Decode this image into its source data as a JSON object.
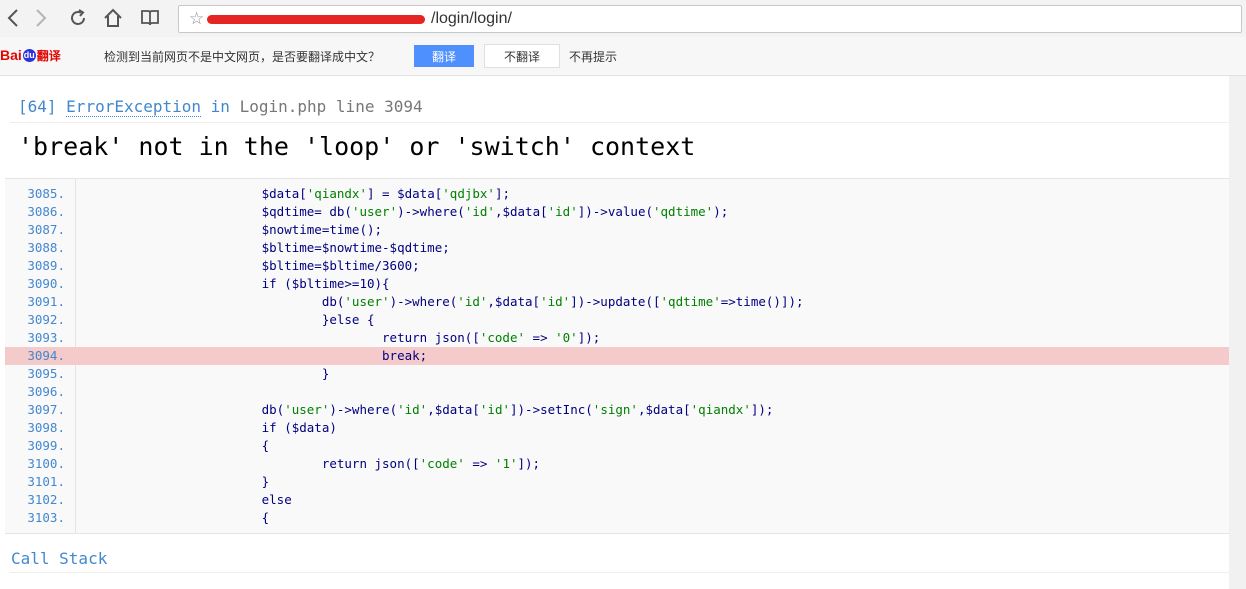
{
  "browser": {
    "url_visible": "/login/login/",
    "back_icon": "chevron-left",
    "forward_icon": "chevron-right",
    "reload_icon": "reload",
    "home_icon": "home",
    "reader_icon": "book-open"
  },
  "translate_bar": {
    "logo_bai": "Bai",
    "logo_du": "du",
    "logo_fanyi": "翻译",
    "message": "检测到当前网页不是中文网页，是否要翻译成中文？",
    "translate_button": "翻译",
    "no_translate_button": "不翻译",
    "never_prompt": "不再提示",
    "accent_color": "#4d90fe"
  },
  "exception": {
    "code": "[64]",
    "type": "ErrorException",
    "in_word": "in",
    "file": "Login.php",
    "line_word": "line",
    "line": "3094",
    "message": "'break' not in the 'loop' or 'switch' context",
    "highlight_line": 3094
  },
  "code_lines": [
    {
      "ln": "3085.",
      "text": "                        $data['qiandx'] = $data['qdjbx'];"
    },
    {
      "ln": "3086.",
      "text": "                        $qdtime= db('user')->where('id',$data['id'])->value('qdtime');"
    },
    {
      "ln": "3087.",
      "text": "                        $nowtime=time();"
    },
    {
      "ln": "3088.",
      "text": "                        $bltime=$nowtime-$qdtime;"
    },
    {
      "ln": "3089.",
      "text": "                        $bltime=$bltime/3600;"
    },
    {
      "ln": "3090.",
      "text": "                        if ($bltime>=10){"
    },
    {
      "ln": "3091.",
      "text": "                                db('user')->where('id',$data['id'])->update(['qdtime'=>time()]);"
    },
    {
      "ln": "3092.",
      "text": "                                }else {"
    },
    {
      "ln": "3093.",
      "text": "                                        return json(['code' => '0']);"
    },
    {
      "ln": "3094.",
      "text": "                                        break;"
    },
    {
      "ln": "3095.",
      "text": "                                }"
    },
    {
      "ln": "3096.",
      "text": ""
    },
    {
      "ln": "3097.",
      "text": "                        db('user')->where('id',$data['id'])->setInc('sign',$data['qiandx']);"
    },
    {
      "ln": "3098.",
      "text": "                        if ($data)"
    },
    {
      "ln": "3099.",
      "text": "                        {"
    },
    {
      "ln": "3100.",
      "text": "                                return json(['code' => '1']);"
    },
    {
      "ln": "3101.",
      "text": "                        }"
    },
    {
      "ln": "3102.",
      "text": "                        else"
    },
    {
      "ln": "3103.",
      "text": "                        {"
    }
  ],
  "call_stack_label": "Call Stack",
  "colors": {
    "link_blue": "#4288ce",
    "highlight": "#f5caca",
    "code_text": "#000080",
    "string": "#008000"
  }
}
